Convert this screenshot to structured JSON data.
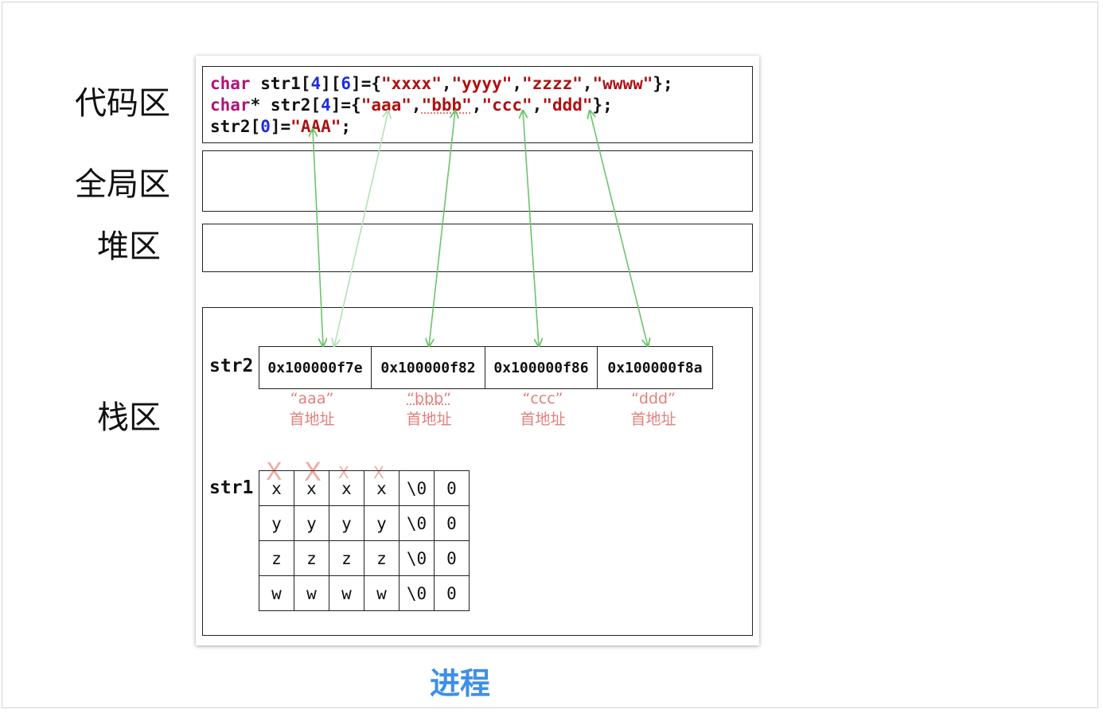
{
  "regions": {
    "code": "代码区",
    "global": "全局区",
    "heap": "堆区",
    "stack": "栈区"
  },
  "code_lines": {
    "line1": {
      "kw": "char",
      "pre": " str1[",
      "n1": "4",
      "mid": "][",
      "n2": "6",
      "post": "]={",
      "s1": "\"xxxx\"",
      "c1": ",",
      "s2": "\"yyyy\"",
      "c2": ",",
      "s3": "\"zzzz\"",
      "c3": ",",
      "s4": "\"wwww\"",
      "end": "};"
    },
    "line2": {
      "kw": "char",
      "pre": "* str2[",
      "n1": "4",
      "post": "]={",
      "s1": "\"aaa\"",
      "c1": ",",
      "s2": "\"bbb\"",
      "c2": ",",
      "s3": "\"ccc\"",
      "c3": ",",
      "s4": "\"ddd\"",
      "end": "};"
    },
    "line3": {
      "pre": "str2[",
      "n1": "0",
      "mid": "]=",
      "s1": "\"AAA\"",
      "end": ";"
    }
  },
  "str2": {
    "label": "str2",
    "addresses": [
      "0x100000f7e",
      "0x100000f82",
      "0x100000f86",
      "0x100000f8a"
    ],
    "notes": [
      {
        "name": "“aaa”",
        "sub": "首地址"
      },
      {
        "name": "“bbb”",
        "sub": "首地址"
      },
      {
        "name": "“ccc”",
        "sub": "首地址"
      },
      {
        "name": "“ddd”",
        "sub": "首地址"
      }
    ]
  },
  "str1": {
    "label": "str1",
    "rows": [
      [
        "x",
        "x",
        "x",
        "x",
        "\\0",
        "0"
      ],
      [
        "y",
        "y",
        "y",
        "y",
        "\\0",
        "0"
      ],
      [
        "z",
        "z",
        "z",
        "z",
        "\\0",
        "0"
      ],
      [
        "w",
        "w",
        "w",
        "w",
        "\\0",
        "0"
      ]
    ],
    "cross_mark": "X"
  },
  "caption": "进程",
  "colors": {
    "arrow": "#6cc46c",
    "arrow_faded": "#b5e0b5",
    "note": "#e3807b",
    "caption": "#3f8fe6",
    "keyword": "#b0127a",
    "number": "#1a2ee0",
    "string": "#b01010"
  }
}
